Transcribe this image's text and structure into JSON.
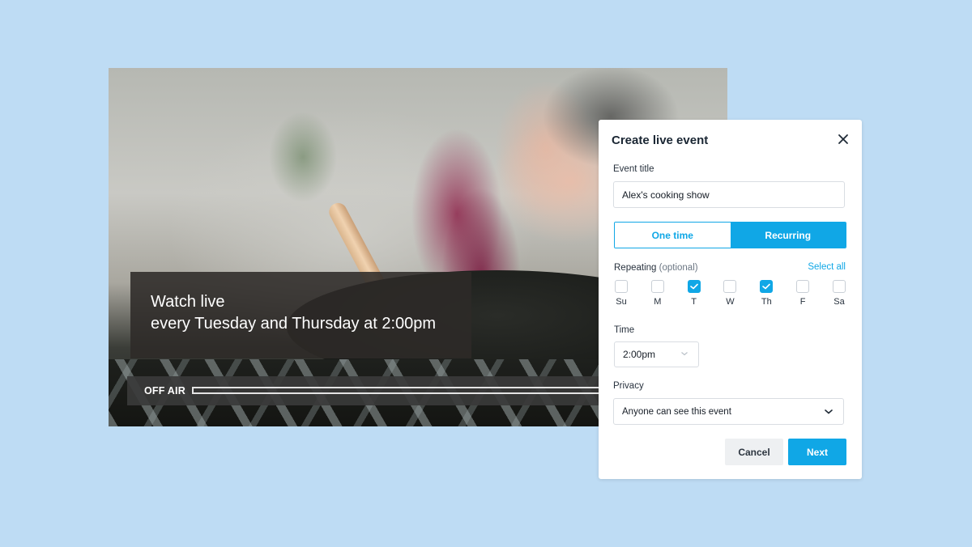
{
  "video": {
    "caption_line1": "Watch live",
    "caption_line2": "every Tuesday and Thursday at 2:00pm",
    "status": "OFF AIR",
    "progress": 0
  },
  "dialog": {
    "title": "Create live event",
    "close_icon": "close-icon",
    "event_title_label": "Event title",
    "event_title_value": "Alex's cooking show",
    "frequency_options": [
      "One time",
      "Recurring"
    ],
    "frequency_selected": "Recurring",
    "repeating_label": "Repeating",
    "repeating_optional": "(optional)",
    "select_all_label": "Select all",
    "days": [
      {
        "label": "Su",
        "checked": false
      },
      {
        "label": "M",
        "checked": false
      },
      {
        "label": "T",
        "checked": true
      },
      {
        "label": "W",
        "checked": false
      },
      {
        "label": "Th",
        "checked": true
      },
      {
        "label": "F",
        "checked": false
      },
      {
        "label": "Sa",
        "checked": false
      }
    ],
    "time_label": "Time",
    "time_value": "2:00pm",
    "privacy_label": "Privacy",
    "privacy_value": "Anyone can see this event",
    "cancel_label": "Cancel",
    "next_label": "Next"
  },
  "colors": {
    "accent": "#10a7e6",
    "background": "#bedcf4"
  }
}
